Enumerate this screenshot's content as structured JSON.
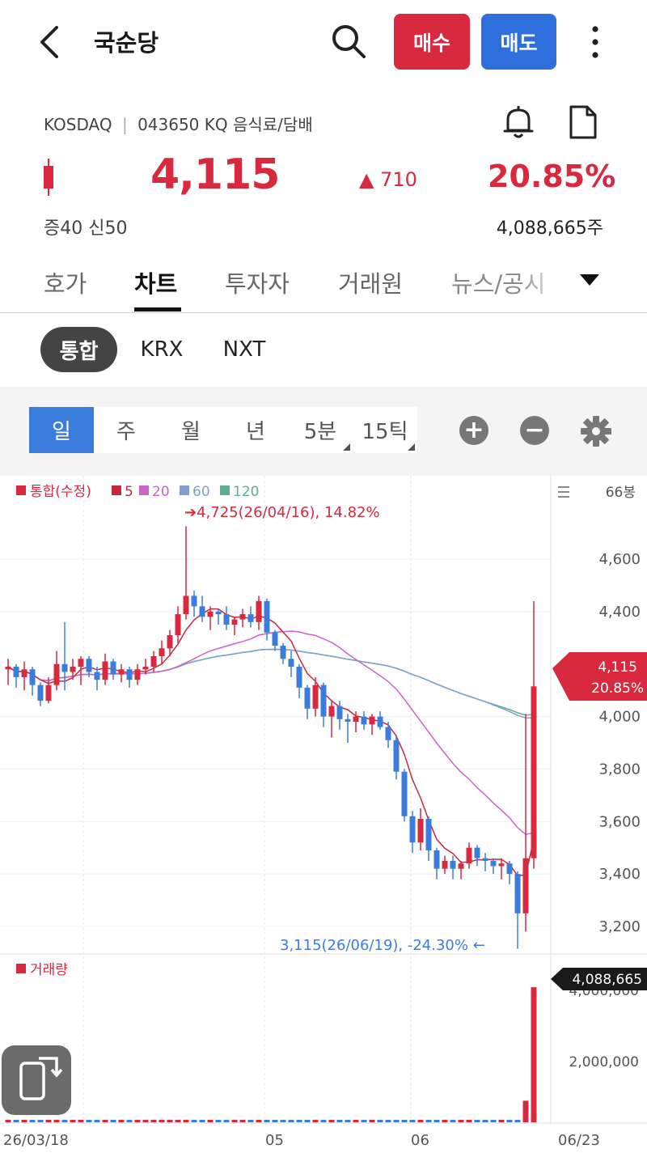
{
  "header": {
    "title": "국순당",
    "buy_label": "매수",
    "sell_label": "매도"
  },
  "stock": {
    "market": "KOSDAQ",
    "code": "043650 KQ",
    "sector": "음식료/담배",
    "price": "4,115",
    "change": "▲ 710",
    "change_pct": "20.85%",
    "margin": "증40  신50",
    "volume": "4,088,665주"
  },
  "tabs": [
    {
      "label": "호가"
    },
    {
      "label": "차트"
    },
    {
      "label": "투자자"
    },
    {
      "label": "거래원"
    },
    {
      "label": "뉴스/공시"
    }
  ],
  "markets": [
    "통합",
    "KRX",
    "NXT"
  ],
  "periods": [
    "일",
    "주",
    "월",
    "년",
    "5분",
    "15틱"
  ],
  "colors": {
    "up": "#d8293f",
    "down": "#3b7ddd",
    "ma5": "#c8283c",
    "ma20": "#c865c8",
    "ma60": "#7fa0cc",
    "ma120": "#5cae8e"
  },
  "chart_data": {
    "type": "candlestick",
    "legend": {
      "main": "통합(수정)",
      "ma5": "5",
      "ma20": "20",
      "ma60": "60",
      "ma120": "120"
    },
    "count_label": "66봉",
    "ylim": [
      3100,
      4800
    ],
    "y_ticks": [
      4600,
      4400,
      4000,
      3800,
      3600,
      3400,
      3200
    ],
    "y_tick_labels": [
      "4,600",
      "4,400",
      "4,000",
      "3,800",
      "3,600",
      "3,400",
      "3,200"
    ],
    "x_labels": [
      "26/03/18",
      "05",
      "06",
      "06/23"
    ],
    "high_annotation": "➔4,725(26/04/16), 14.82%",
    "low_annotation": "3,115(26/06/19), -24.30%  ←",
    "current_tag": {
      "price": "4,115",
      "pct": "20.85%"
    },
    "volume": {
      "label": "거래량",
      "tag": "4,088,665",
      "y_ticks": [
        4000000,
        2000000
      ],
      "y_tick_labels": [
        "4,000,000",
        "2,000,000"
      ],
      "ylim": [
        0,
        4500000
      ],
      "values": [
        40000,
        40000,
        40000,
        40000,
        40000,
        40000,
        40000,
        40000,
        40000,
        40000,
        40000,
        40000,
        40000,
        40000,
        40000,
        40000,
        40000,
        40000,
        40000,
        40000,
        40000,
        40000,
        40000,
        40000,
        40000,
        40000,
        40000,
        40000,
        40000,
        40000,
        40000,
        40000,
        40000,
        40000,
        40000,
        40000,
        40000,
        40000,
        40000,
        40000,
        40000,
        40000,
        40000,
        40000,
        40000,
        40000,
        40000,
        40000,
        40000,
        40000,
        40000,
        40000,
        40000,
        40000,
        40000,
        40000,
        40000,
        40000,
        40000,
        40000,
        40000,
        40000,
        40000,
        40000,
        900000,
        4088665
      ]
    },
    "ohlc": [
      [
        4180,
        4220,
        4120,
        4190
      ],
      [
        4190,
        4200,
        4110,
        4150
      ],
      [
        4150,
        4210,
        4100,
        4180
      ],
      [
        4180,
        4190,
        4080,
        4120
      ],
      [
        4120,
        4130,
        4040,
        4060
      ],
      [
        4060,
        4150,
        4050,
        4120
      ],
      [
        4120,
        4250,
        4100,
        4200
      ],
      [
        4200,
        4360,
        4100,
        4170
      ],
      [
        4170,
        4220,
        4140,
        4190
      ],
      [
        4190,
        4230,
        4120,
        4220
      ],
      [
        4220,
        4230,
        4150,
        4170
      ],
      [
        4170,
        4190,
        4100,
        4140
      ],
      [
        4140,
        4240,
        4120,
        4210
      ],
      [
        4210,
        4220,
        4140,
        4160
      ],
      [
        4160,
        4200,
        4130,
        4180
      ],
      [
        4180,
        4190,
        4110,
        4140
      ],
      [
        4140,
        4200,
        4120,
        4180
      ],
      [
        4180,
        4220,
        4160,
        4190
      ],
      [
        4190,
        4250,
        4170,
        4230
      ],
      [
        4230,
        4290,
        4200,
        4260
      ],
      [
        4260,
        4330,
        4230,
        4310
      ],
      [
        4310,
        4420,
        4280,
        4390
      ],
      [
        4390,
        4725,
        4370,
        4460
      ],
      [
        4460,
        4480,
        4380,
        4420
      ],
      [
        4420,
        4460,
        4360,
        4380
      ],
      [
        4380,
        4420,
        4330,
        4400
      ],
      [
        4400,
        4410,
        4350,
        4390
      ],
      [
        4390,
        4420,
        4330,
        4350
      ],
      [
        4350,
        4380,
        4310,
        4370
      ],
      [
        4370,
        4410,
        4340,
        4390
      ],
      [
        4390,
        4420,
        4340,
        4360
      ],
      [
        4360,
        4460,
        4330,
        4440
      ],
      [
        4440,
        4450,
        4290,
        4320
      ],
      [
        4320,
        4330,
        4250,
        4270
      ],
      [
        4270,
        4280,
        4200,
        4220
      ],
      [
        4220,
        4250,
        4150,
        4190
      ],
      [
        4190,
        4200,
        4070,
        4110
      ],
      [
        4110,
        4120,
        3990,
        4030
      ],
      [
        4030,
        4150,
        4000,
        4120
      ],
      [
        4120,
        4130,
        3960,
        4000
      ],
      [
        4000,
        4060,
        3920,
        4040
      ],
      [
        4040,
        4060,
        3950,
        3990
      ],
      [
        3990,
        4010,
        3900,
        3980
      ],
      [
        3980,
        4020,
        3940,
        4000
      ],
      [
        4000,
        4020,
        3950,
        3970
      ],
      [
        3970,
        4010,
        3930,
        4000
      ],
      [
        4000,
        4020,
        3950,
        3960
      ],
      [
        3960,
        3980,
        3880,
        3910
      ],
      [
        3910,
        3930,
        3760,
        3790
      ],
      [
        3790,
        3800,
        3600,
        3620
      ],
      [
        3620,
        3640,
        3480,
        3520
      ],
      [
        3520,
        3650,
        3490,
        3610
      ],
      [
        3610,
        3620,
        3450,
        3490
      ],
      [
        3490,
        3500,
        3380,
        3420
      ],
      [
        3420,
        3470,
        3400,
        3450
      ],
      [
        3450,
        3470,
        3380,
        3420
      ],
      [
        3420,
        3450,
        3380,
        3440
      ],
      [
        3440,
        3520,
        3420,
        3500
      ],
      [
        3500,
        3510,
        3430,
        3460
      ],
      [
        3460,
        3480,
        3410,
        3450
      ],
      [
        3450,
        3460,
        3400,
        3430
      ],
      [
        3430,
        3460,
        3380,
        3440
      ],
      [
        3440,
        3450,
        3360,
        3400
      ],
      [
        3400,
        3410,
        3115,
        3250
      ],
      [
        3250,
        4010,
        3180,
        3460
      ],
      [
        3460,
        4440,
        3420,
        4115
      ]
    ]
  }
}
